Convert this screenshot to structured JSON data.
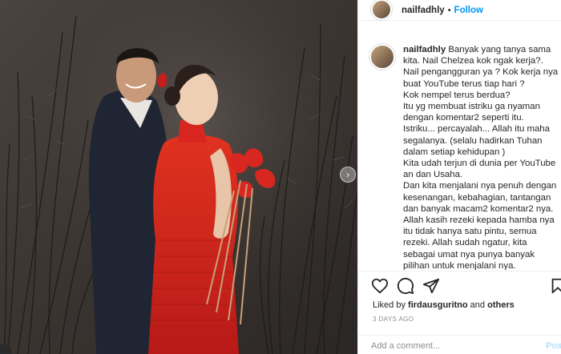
{
  "post": {
    "username": "nailfadhly",
    "separator": "•",
    "follow_label": "Follow",
    "caption": "Banyak yang tanya sama kita. Nail Chelzea kok ngak kerja?. Nail pengangguran ya ? Kok kerja nya buat YouTube terus tiap hari ?\nKok nempel terus berdua?\nItu yg membuat istriku ga nyaman dengan komentar2 seperti itu.\nIstriku... percayalah... Allah itu maha segalanya. (selalu hadirkan Tuhan dalam setiap kehidupan )\nKita udah terjun di dunia per YouTube an dan Usaha.\nDan kita menjalani nya penuh dengan kesenangan, kebahagian, tantangan dan banyak macam2 komentar2 nya.\nAllah kasih rezeki kepada hamba nya itu tidak hanya satu pintu, semua rezeki. Allah sudah ngatur, kita sebagai umat nya punya banyak pilihan untuk menjalani nya.",
    "likes_prefix": "Liked by",
    "liked_by_user": "firdausguritno",
    "likes_and": "and",
    "likes_others": "others",
    "timestamp": "3 DAYS AGO",
    "comment_placeholder": "Add a comment...",
    "post_button": "Post",
    "carousel_next": "›"
  },
  "icons": {
    "like": "heart-icon",
    "comment": "comment-icon",
    "share": "paper-plane-icon",
    "save": "bookmark-icon"
  },
  "colors": {
    "accent": "#0095f6",
    "post_disabled": "#b2dffc",
    "text": "#262626",
    "muted": "#8e8e8e",
    "dress": "#d8251f"
  }
}
